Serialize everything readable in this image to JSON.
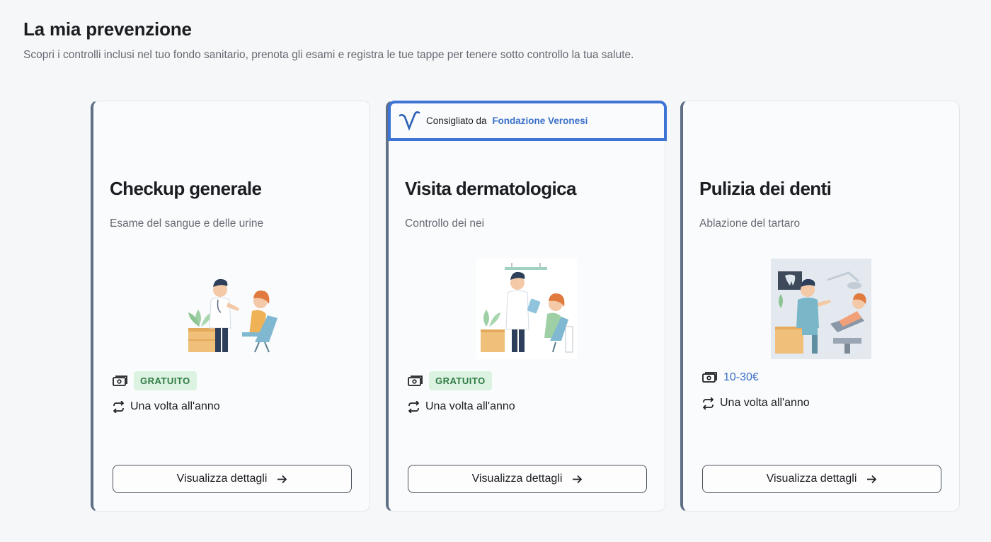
{
  "header": {
    "title": "La mia prevenzione",
    "subtitle": "Scopri i controlli inclusi nel tuo fondo sanitario, prenota gli esami e registra le tue tappe per tenere sotto controllo la tua salute."
  },
  "cards": [
    {
      "title": "Checkup generale",
      "description": "Esame del sangue e delle urine",
      "price_badge": "GRATUITO",
      "frequency": "Una volta all'anno",
      "button_label": "Visualizza dettagli",
      "illustration": "doctor-patient-consultation-illustration"
    },
    {
      "recommendation_prefix": "Consigliato da",
      "recommendation_org": "Fondazione Veronesi",
      "title": "Visita dermatologica",
      "description": "Controllo dei nei",
      "price_badge": "GRATUITO",
      "frequency": "Una volta all'anno",
      "button_label": "Visualizza dettagli",
      "illustration": "dermatology-visit-illustration"
    },
    {
      "title": "Pulizia dei denti",
      "description": "Ablazione del tartaro",
      "price_text": "10-30€",
      "frequency": "Una volta all'anno",
      "button_label": "Visualizza dettagli",
      "illustration": "dental-cleaning-illustration"
    }
  ],
  "colors": {
    "card_accent": "#5f6f86",
    "recommend_border": "#3d74d6",
    "free_badge_bg": "#dcf3e2",
    "free_badge_text": "#2f7a43",
    "price_text": "#3a6fc9"
  }
}
